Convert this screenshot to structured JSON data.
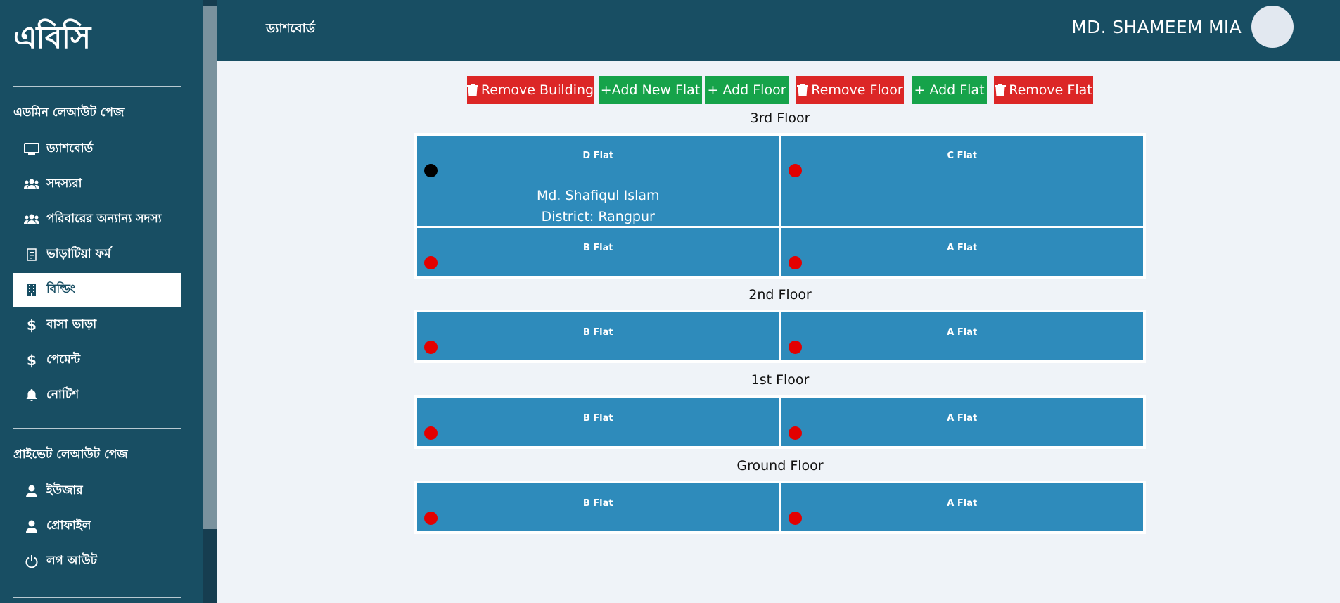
{
  "brand": "এবিসি",
  "sidebar": {
    "admin_section": "এডমিন লেআউট পেজ",
    "admin_items": [
      {
        "label": "ড্যাশবোর্ড",
        "icon": "monitor-icon"
      },
      {
        "label": "সদস্যরা",
        "icon": "users-icon"
      },
      {
        "label": "পরিবারের অন্যান্য সদস্য",
        "icon": "users-icon"
      },
      {
        "label": "ভাড়াটিয়া ফর্ম",
        "icon": "form-icon"
      },
      {
        "label": "বিল্ডিং",
        "icon": "building-icon",
        "active": true
      },
      {
        "label": "বাসা ভাড়া",
        "icon": "dollar-icon"
      },
      {
        "label": "পেমেন্ট",
        "icon": "dollar-icon"
      },
      {
        "label": "নোটিশ",
        "icon": "bell-icon"
      }
    ],
    "private_section": "প্রাইভেট লেআউট পেজ",
    "private_items": [
      {
        "label": "ইউজার",
        "icon": "user-icon"
      },
      {
        "label": "প্রোফাইল",
        "icon": "user-icon"
      },
      {
        "label": "লগ আউট",
        "icon": "power-icon"
      }
    ]
  },
  "header": {
    "breadcrumb": "ড্যাশবোর্ড",
    "user_name": "MD. SHAMEEM MIA"
  },
  "toolbar": {
    "remove_building": "Remove Building",
    "add_new_flat": "+Add New Flat",
    "add_floor": "+ Add Floor",
    "remove_floor": "Remove Floor",
    "add_flat": "+ Add Flat",
    "remove_flat": "Remove Flat"
  },
  "floors": [
    {
      "title": "3rd Floor",
      "rows": [
        [
          {
            "name": "D Flat",
            "occupied": true,
            "tenant": "Md. Shafiqul Islam",
            "district": "District: Rangpur"
          },
          {
            "name": "C Flat",
            "occupied": false
          }
        ],
        [
          {
            "name": "B Flat",
            "occupied": false
          },
          {
            "name": "A Flat",
            "occupied": false
          }
        ]
      ]
    },
    {
      "title": "2nd Floor",
      "rows": [
        [
          {
            "name": "B Flat",
            "occupied": false
          },
          {
            "name": "A Flat",
            "occupied": false
          }
        ]
      ]
    },
    {
      "title": "1st Floor",
      "rows": [
        [
          {
            "name": "B Flat",
            "occupied": false
          },
          {
            "name": "A Flat",
            "occupied": false
          }
        ]
      ]
    },
    {
      "title": "Ground Floor",
      "rows": [
        [
          {
            "name": "B Flat",
            "occupied": false
          },
          {
            "name": "A Flat",
            "occupied": false
          }
        ]
      ]
    }
  ],
  "colors": {
    "sidebar": "#184e63",
    "flat": "#2e8bbb",
    "vacant_dot": "#e30000",
    "occupied_dot": "#000000",
    "danger": "#dc2626",
    "success": "#16a34a"
  }
}
